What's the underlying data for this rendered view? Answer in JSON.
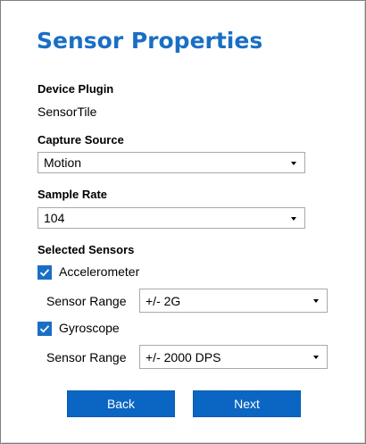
{
  "title": "Sensor Properties",
  "device_plugin": {
    "label": "Device Plugin",
    "value": "SensorTile"
  },
  "capture_source": {
    "label": "Capture Source",
    "selected": "Motion"
  },
  "sample_rate": {
    "label": "Sample Rate",
    "selected": "104"
  },
  "selected_sensors": {
    "label": "Selected Sensors",
    "sensors": [
      {
        "name": "Accelerometer",
        "checked": true,
        "range_label": "Sensor Range",
        "range_value": "+/- 2G"
      },
      {
        "name": "Gyroscope",
        "checked": true,
        "range_label": "Sensor Range",
        "range_value": "+/- 2000 DPS"
      }
    ]
  },
  "buttons": {
    "back": "Back",
    "next": "Next"
  },
  "colors": {
    "accent": "#1a6fc4",
    "button": "#0a66c2"
  }
}
